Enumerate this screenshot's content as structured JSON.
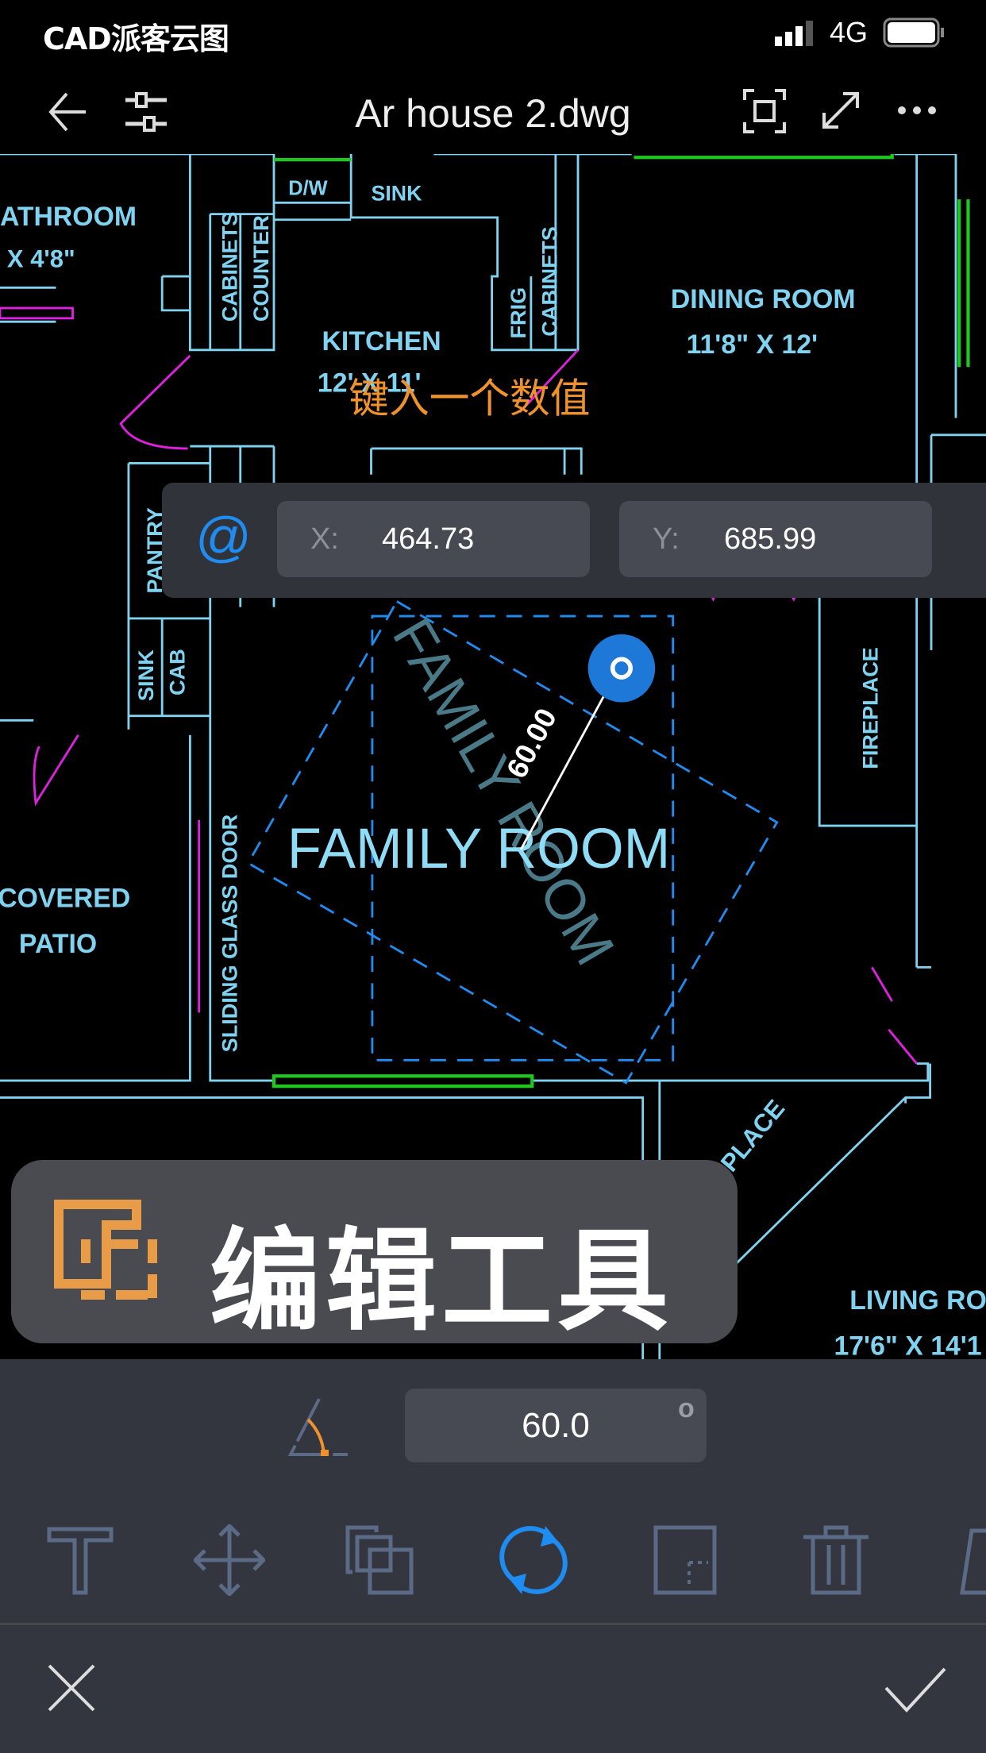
{
  "status_bar": {
    "carrier": "CAD派客云图",
    "network": "4G",
    "signal_icon": "signal-icon",
    "battery_icon": "battery-icon"
  },
  "header": {
    "title": "Ar house 2.dwg",
    "back_icon": "arrow-left-icon",
    "settings_icon": "sliders-icon",
    "fit_icon": "fit-screen-icon",
    "fullscreen_icon": "expand-icon",
    "more_icon": "more-icon"
  },
  "drawing": {
    "prompt": "键入一个数值",
    "labels": {
      "bathroom": "ATHROOM",
      "bathroom_size": "' X 4'8\"",
      "cabinets_left": "CABINETS",
      "counter": "COUNTER",
      "dw": "D/W",
      "sink_kitchen": "SINK",
      "frig": "FRIG",
      "cabinets_right": "CABINETS",
      "kitchen": "KITCHEN",
      "kitchen_size": "12' X 11'",
      "dining": "DINING ROOM",
      "dining_size": "11'8\" X 12'",
      "pantry": "PANTRY",
      "sink_small": "SINK",
      "cab": "CAB",
      "family": "FAMILY ROOM",
      "family_rotated": "FAMILY ROOM",
      "angle_dim": "60.00",
      "sliding": "SLIDING GLASS DOOR",
      "fireplace": "FIREPLACE",
      "covered": "COVERED",
      "patio": "PATIO",
      "place": "PLACE",
      "living": "LIVING RO",
      "living_size": "17'6\" X 14'1"
    },
    "colors": {
      "wall": "#7fd3f0",
      "door": "#e020e0",
      "window": "#1ec81e",
      "selection": "#1e8cf0",
      "prompt": "#f0922b"
    }
  },
  "coordinate_input": {
    "mode_icon": "at-icon",
    "mode": "@",
    "x_label": "X:",
    "x_value": "464.73",
    "y_label": "Y:",
    "y_value": "685.99"
  },
  "banner": {
    "icon": "edit-tool-icon",
    "text": "编辑工具"
  },
  "rotate_panel": {
    "angle_icon": "angle-icon",
    "angle_value": "60.0",
    "unit": "o"
  },
  "toolbar": [
    {
      "icon": "text-icon",
      "active": false
    },
    {
      "icon": "move-icon",
      "active": false
    },
    {
      "icon": "copy-icon",
      "active": false
    },
    {
      "icon": "rotate-icon",
      "active": true
    },
    {
      "icon": "scale-icon",
      "active": false
    },
    {
      "icon": "delete-icon",
      "active": false
    },
    {
      "icon": "stretch-icon",
      "active": false
    }
  ],
  "actions": {
    "cancel_icon": "close-icon",
    "confirm_icon": "check-icon"
  }
}
